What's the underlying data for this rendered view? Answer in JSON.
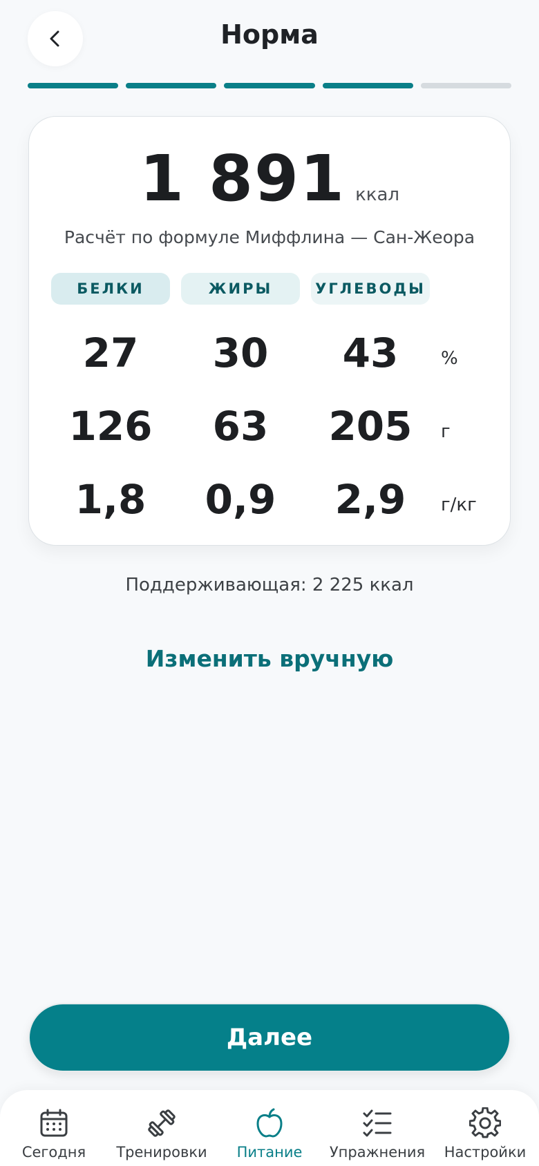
{
  "header": {
    "title": "Норма",
    "back_icon": "chevron-left-icon"
  },
  "progress": {
    "total_steps": 5,
    "completed_steps": 4,
    "accent": "#0a7f88"
  },
  "card": {
    "kcal_value": "1 891",
    "kcal_unit": "ккал",
    "formula": "Расчёт по формуле Миффлина — Сан-Жеора",
    "macros": {
      "protein": "БЕЛКИ",
      "fat": "ЖИРЫ",
      "carbs": "УГЛЕВОДЫ"
    },
    "rows": [
      {
        "protein": "27",
        "fat": "30",
        "carbs": "43",
        "unit": "%"
      },
      {
        "protein": "126",
        "fat": "63",
        "carbs": "205",
        "unit": "г"
      },
      {
        "protein": "1,8",
        "fat": "0,9",
        "carbs": "2,9",
        "unit": "г/кг"
      }
    ]
  },
  "maintenance": "Поддерживающая: 2 225 ккал",
  "edit_link": "Изменить вручную",
  "next_button": "Далее",
  "tabbar": {
    "items": [
      {
        "label": "Сегодня",
        "icon": "calendar-icon"
      },
      {
        "label": "Тренировки",
        "icon": "dumbbell-icon"
      },
      {
        "label": "Питание",
        "icon": "apple-icon",
        "active": true
      },
      {
        "label": "Упражнения",
        "icon": "checklist-icon"
      },
      {
        "label": "Настройки",
        "icon": "gear-icon"
      }
    ],
    "active_color": "#0a7f88"
  }
}
